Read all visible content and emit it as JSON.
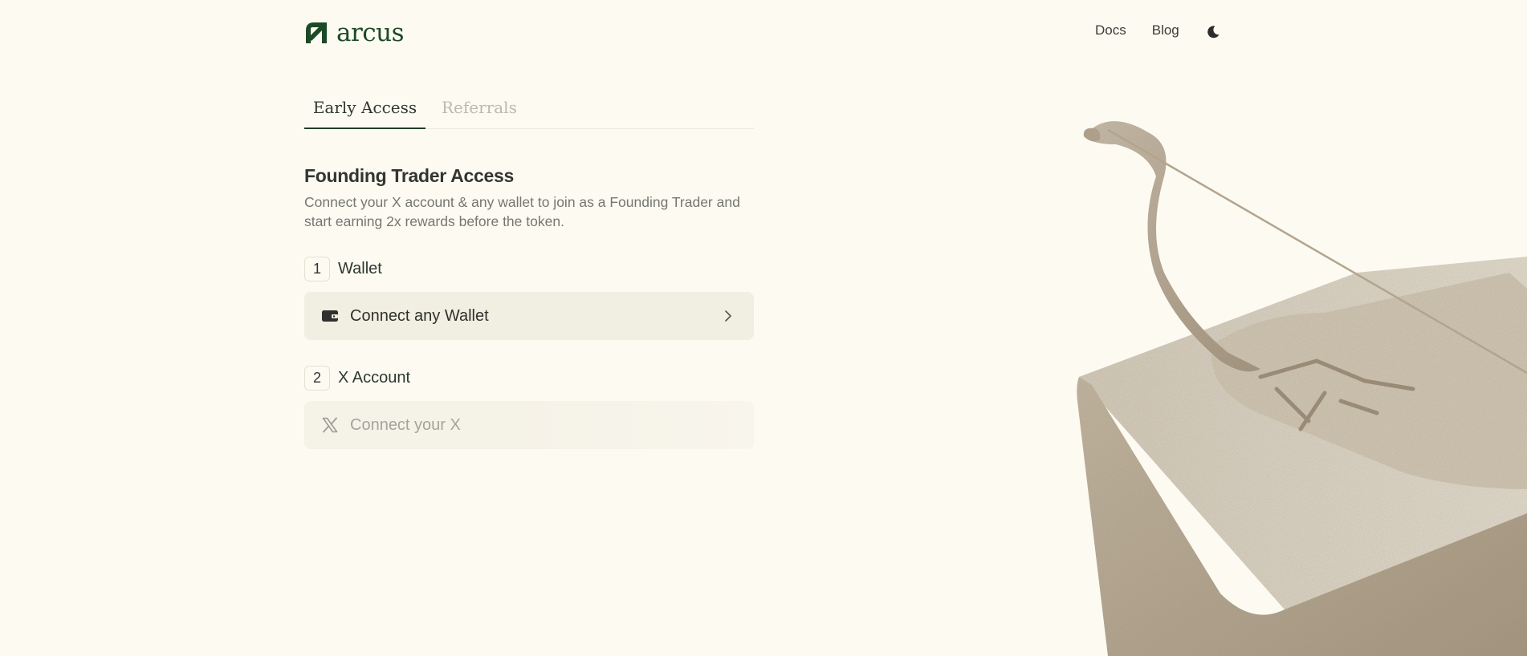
{
  "header": {
    "brand": "arcus",
    "logo_icon": "arcus-logo-icon",
    "nav": [
      {
        "label": "Docs"
      },
      {
        "label": "Blog"
      }
    ],
    "theme_icon": "moon-icon"
  },
  "tabs": [
    {
      "label": "Early Access",
      "active": true
    },
    {
      "label": "Referrals",
      "active": false
    }
  ],
  "main": {
    "title": "Founding Trader Access",
    "description": "Connect your X account & any wallet to join as a Founding Trader and start earning 2x rewards before the token.",
    "steps": [
      {
        "number": "1",
        "label": "Wallet",
        "action_label": "Connect any Wallet",
        "action_icon": "wallet-icon",
        "trailing_icon": "chevron-right-icon",
        "enabled": true
      },
      {
        "number": "2",
        "label": "X Account",
        "action_label": "Connect your X",
        "action_icon": "x-logo-icon",
        "enabled": false
      }
    ]
  },
  "colors": {
    "background": "#fdfaf2",
    "brand": "#1d4a26",
    "card": "#f1eee2",
    "muted_text": "#75776f"
  }
}
